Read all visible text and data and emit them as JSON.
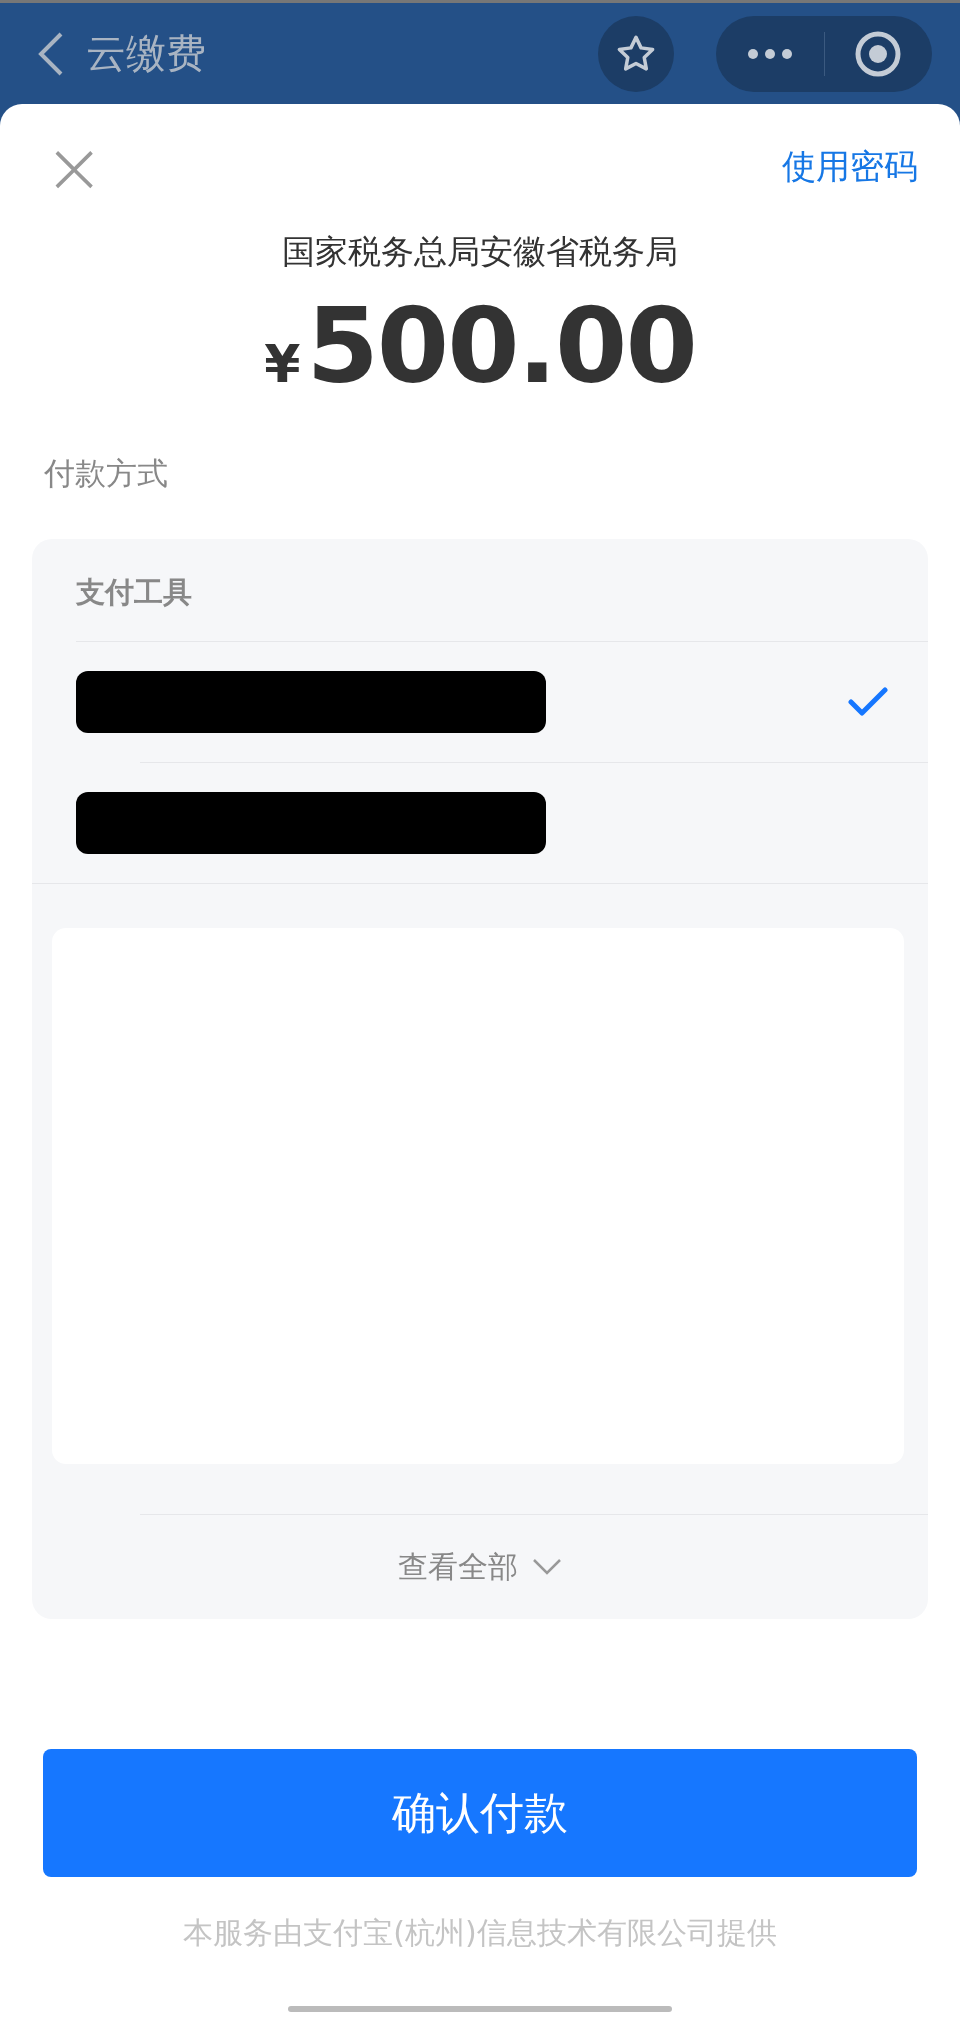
{
  "nav_bar": {
    "title": "云缴费"
  },
  "sheet": {
    "close": "×",
    "switch_link": "使用密码",
    "merchant": "国家税务总局安徽省税务局",
    "currency": "¥",
    "amount": "500.00",
    "method_label": "付款方式"
  },
  "payment_tools": {
    "heading": "支付工具",
    "options": [
      {
        "selected": true
      },
      {
        "selected": false
      }
    ],
    "view_all": "查看全部"
  },
  "confirm_button": "确认付款",
  "footer": "本服务由支付宝(杭州)信息技术有限公司提供"
}
